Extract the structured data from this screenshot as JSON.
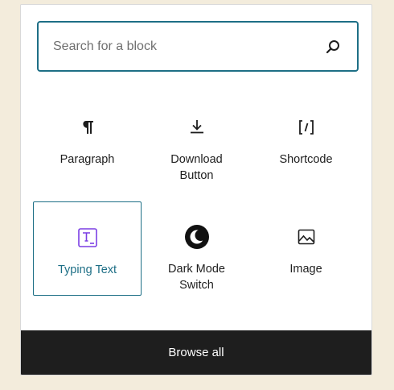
{
  "search": {
    "placeholder": "Search for a block",
    "value": ""
  },
  "blocks": [
    {
      "label": "Paragraph",
      "icon": "paragraph-icon",
      "selected": false
    },
    {
      "label": "Download\nButton",
      "icon": "download-icon",
      "selected": false
    },
    {
      "label": "Shortcode",
      "icon": "shortcode-icon",
      "selected": false
    },
    {
      "label": "Typing Text",
      "icon": "typing-text-icon",
      "selected": true
    },
    {
      "label": "Dark Mode\nSwitch",
      "icon": "dark-mode-icon",
      "selected": false
    },
    {
      "label": "Image",
      "icon": "image-icon",
      "selected": false
    }
  ],
  "footer": {
    "browse_label": "Browse all"
  },
  "colors": {
    "accent": "#1e6f86",
    "typing_icon": "#7b3fe4",
    "footer_bg": "#1e1e1e",
    "page_bg": "#f3ecdc"
  }
}
